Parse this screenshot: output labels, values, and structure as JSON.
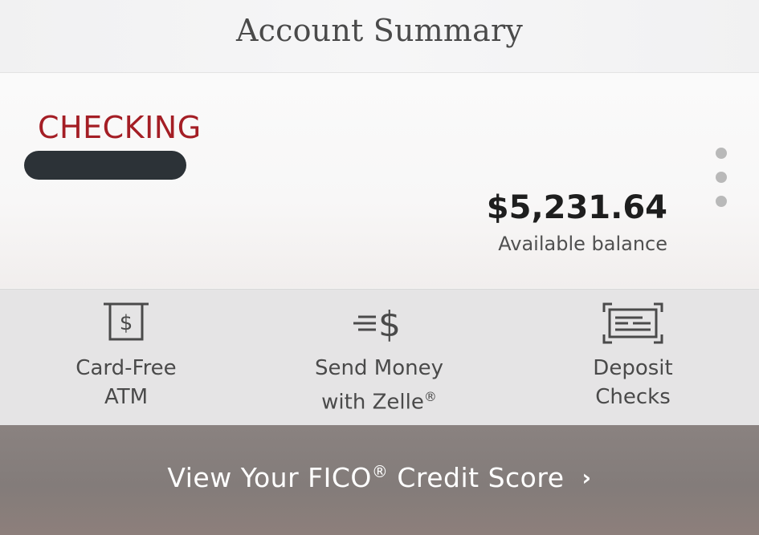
{
  "header": {
    "title": "Account Summary"
  },
  "account": {
    "name": "CHECKING",
    "number_masked": "",
    "balance": "$5,231.64",
    "balance_label": "Available balance"
  },
  "actions": [
    {
      "line1": "Card-Free",
      "line2": "ATM",
      "sup": "",
      "icon": "atm-dollar-icon"
    },
    {
      "line1": "Send Money",
      "line2": "with Zelle",
      "sup": "®",
      "icon": "send-money-icon"
    },
    {
      "line1": "Deposit",
      "line2": "Checks",
      "sup": "",
      "icon": "deposit-check-icon"
    }
  ],
  "banner": {
    "text_before": "View Your FICO",
    "sup": "®",
    "text_after": " Credit Score",
    "chevron": "›"
  },
  "colors": {
    "brand_red": "#a41e25",
    "mask": "#2c3237",
    "actions_bg": "#e5e4e5",
    "banner_bg": "#857d7b"
  }
}
